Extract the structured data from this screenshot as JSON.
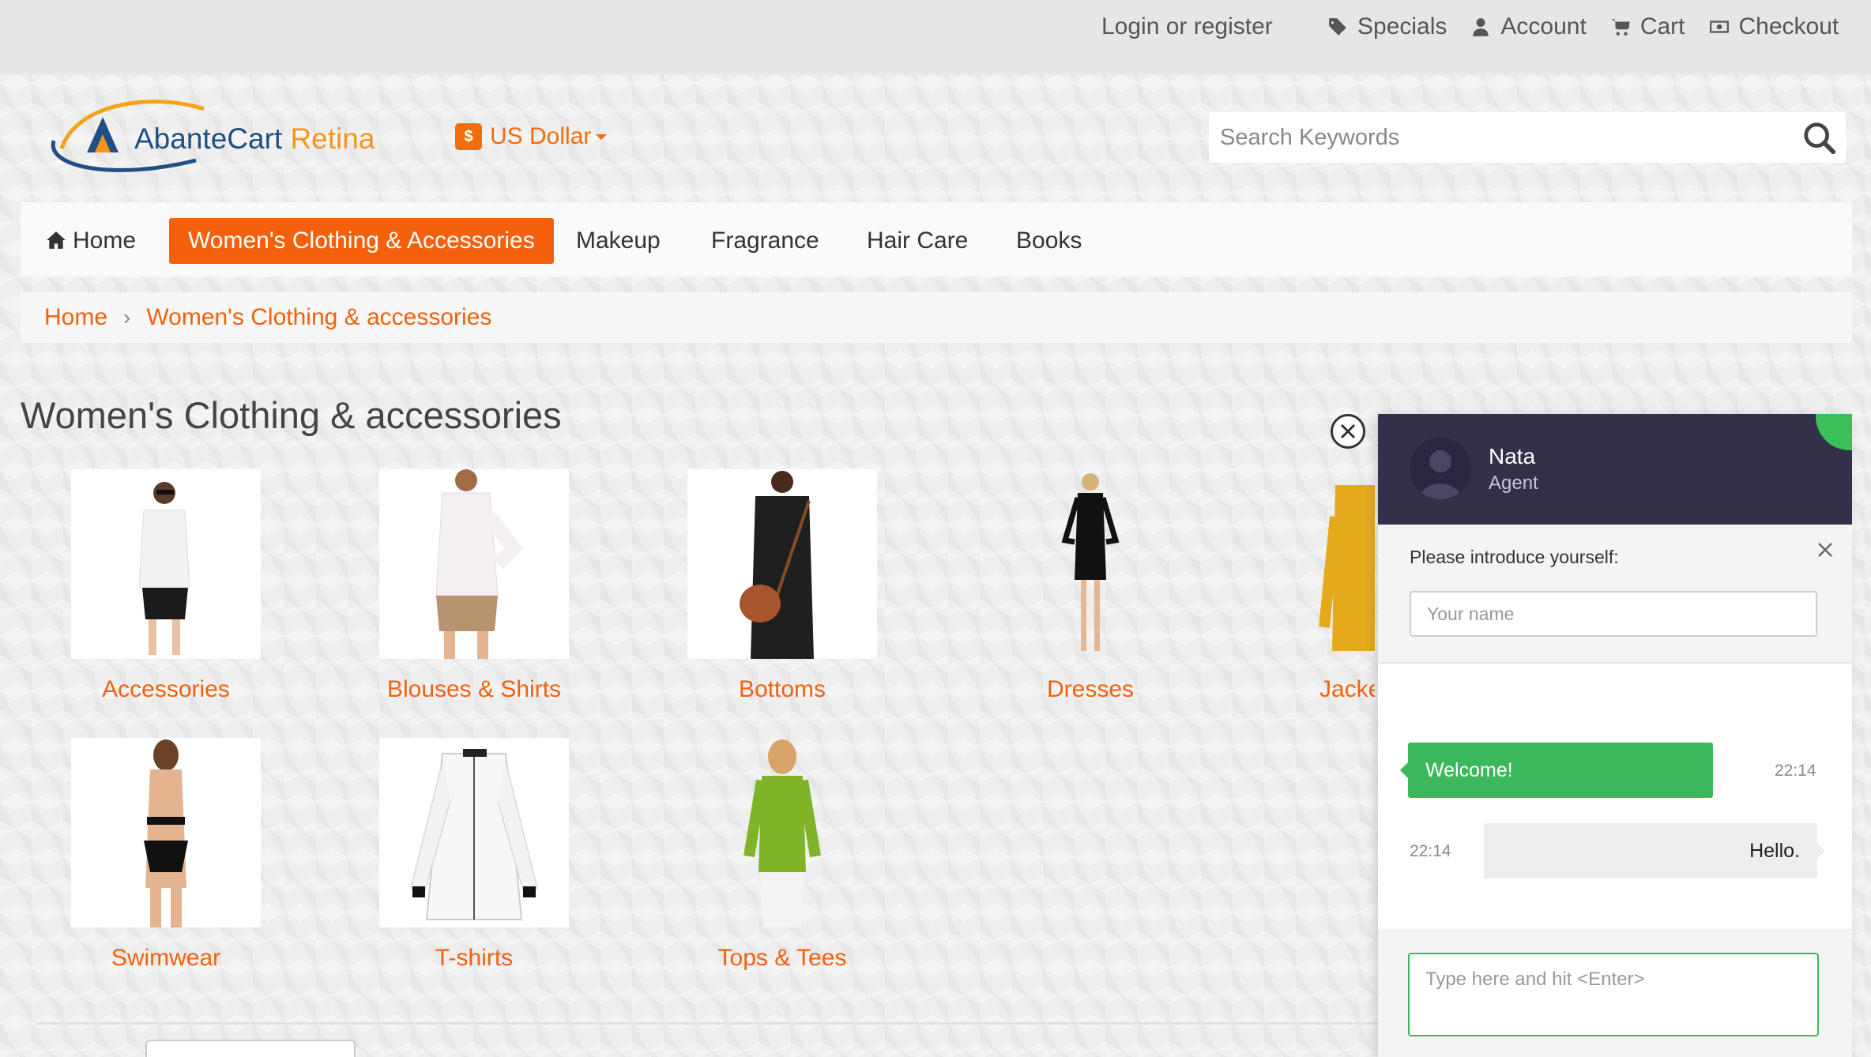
{
  "topbar": {
    "login_label": "Login or register",
    "links": [
      {
        "label": "Specials",
        "icon": "tag-icon"
      },
      {
        "label": "Account",
        "icon": "user-icon"
      },
      {
        "label": "Cart",
        "icon": "cart-icon"
      },
      {
        "label": "Checkout",
        "icon": "money-icon"
      }
    ]
  },
  "header": {
    "logo_text_main": "AbanteCart",
    "logo_text_accent": "Retina",
    "currency_symbol": "$",
    "currency_label": "US Dollar",
    "search_placeholder": "Search Keywords"
  },
  "nav": {
    "items": [
      {
        "label": "Home",
        "icon": "home-icon"
      },
      {
        "label": "Women's Clothing & Accessories",
        "active": true
      },
      {
        "label": "Makeup"
      },
      {
        "label": "Fragrance"
      },
      {
        "label": "Hair Care"
      },
      {
        "label": "Books"
      }
    ]
  },
  "breadcrumb": {
    "items": [
      "Home",
      "Women's Clothing & accessories"
    ],
    "separator": "›"
  },
  "page": {
    "title": "Women's Clothing & accessories"
  },
  "categories": [
    {
      "label": "Accessories"
    },
    {
      "label": "Blouses & Shirts"
    },
    {
      "label": "Bottoms"
    },
    {
      "label": "Dresses"
    },
    {
      "label": "Jackets"
    },
    {
      "label": "Swimwear"
    },
    {
      "label": "T-shirts"
    },
    {
      "label": "Tops & Tees"
    }
  ],
  "chat": {
    "agent_name": "Nata",
    "agent_role": "Agent",
    "intro_label": "Please introduce yourself:",
    "name_placeholder": "Your name",
    "messages": [
      {
        "from": "agent",
        "text": "Welcome!",
        "time": "22:14"
      },
      {
        "from": "user",
        "text": "Hello.",
        "time": "22:14"
      }
    ],
    "composer_placeholder": "Type here and hit <Enter>"
  },
  "colors": {
    "accent": "#f4600c",
    "chat_header": "#35304a",
    "chat_green": "#3cb85c"
  }
}
